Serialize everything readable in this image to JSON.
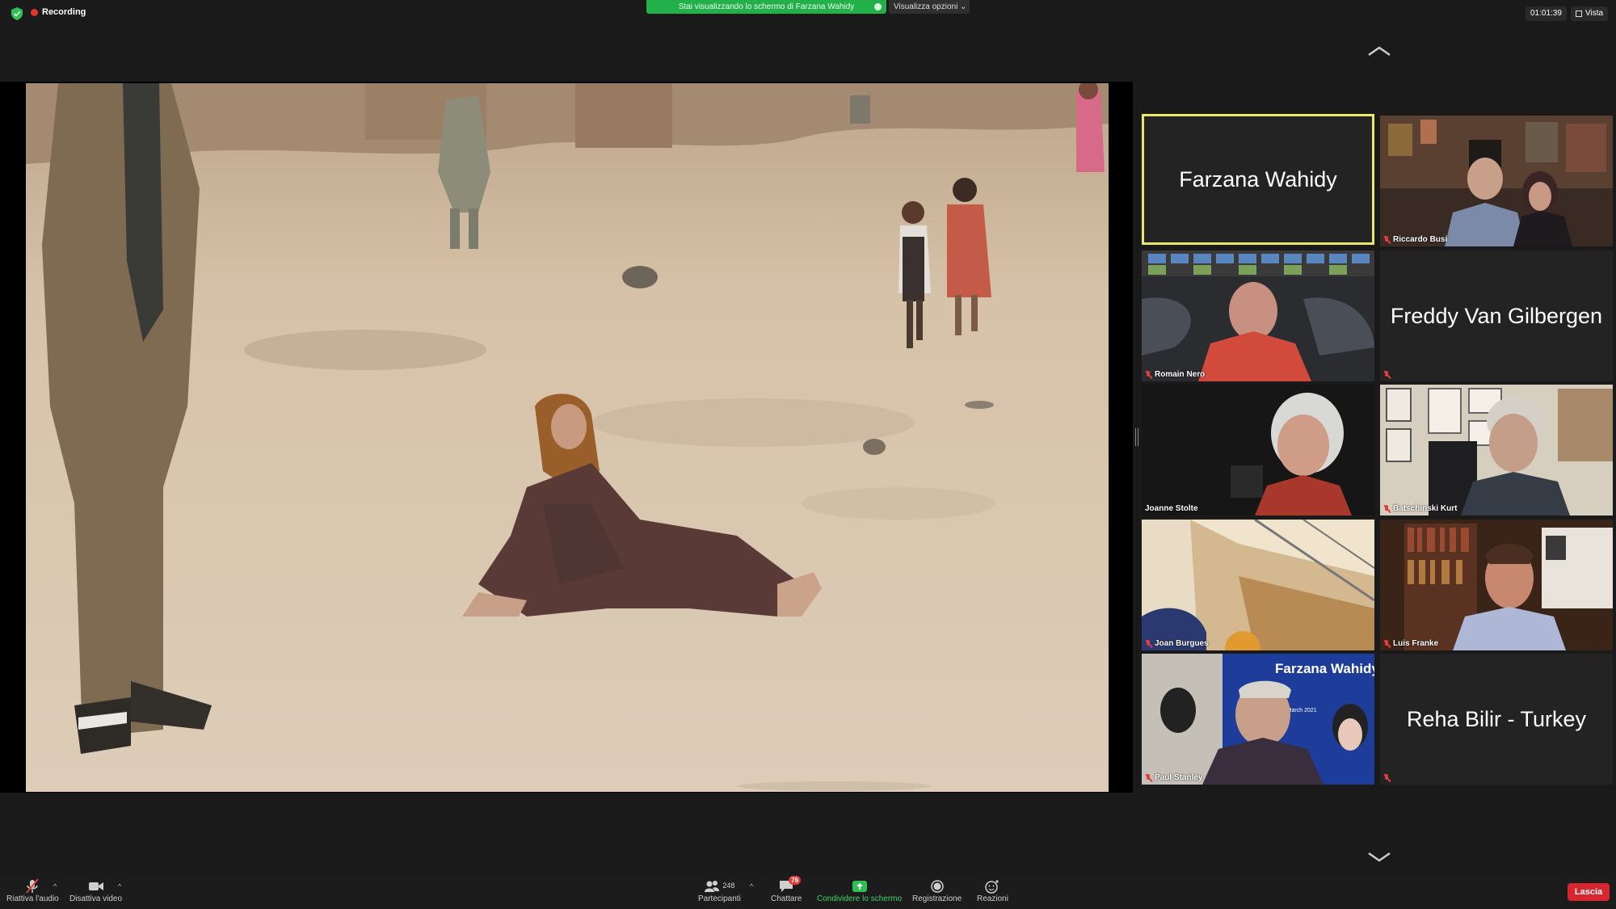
{
  "topbar": {
    "recording_label": "Recording",
    "share_banner": "Stai visualizzando lo schermo di Farzana Wahidy",
    "view_options": "Visualizza opzioni ⌄",
    "timer": "01:01:39",
    "view_label": "Vista"
  },
  "gallery": {
    "tiles": [
      {
        "name": "Farzana Wahidy",
        "type": "name-only",
        "active": true
      },
      {
        "name": "Riccardo Busi",
        "type": "video",
        "muted": true
      },
      {
        "name": "Romain Nero",
        "type": "video",
        "muted": true
      },
      {
        "name": "Freddy Van Gilbergen",
        "type": "name-only",
        "muted": true
      },
      {
        "name": "Joanne Stolte",
        "type": "video",
        "muted": false
      },
      {
        "name": "Batschinski Kurt",
        "type": "video",
        "muted": true
      },
      {
        "name": "Joan Burgues",
        "type": "video",
        "muted": true
      },
      {
        "name": "Luis Franke",
        "type": "video",
        "muted": true
      },
      {
        "name": "Paul Stanley",
        "type": "video",
        "muted": true
      },
      {
        "name": "Reha Bilir - Turkey",
        "type": "name-only",
        "muted": true
      }
    ],
    "poster_title": "Farzana Wahidy",
    "poster_date": "7th March 2021"
  },
  "toolbar": {
    "audio": "Riattiva l'audio",
    "video": "Disattiva video",
    "participants": "Partecipanti",
    "participants_count": "248",
    "chat": "Chattare",
    "chat_badge": "76",
    "share": "Condividere lo schermo",
    "record": "Registrazione",
    "reactions": "Reazioni",
    "leave": "Lascia"
  },
  "colors": {
    "share_green": "#23b04a",
    "active_outline": "#e9e86a",
    "leave_red": "#d8262f",
    "muted_red": "#e23c3c"
  }
}
